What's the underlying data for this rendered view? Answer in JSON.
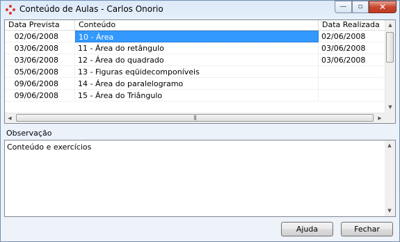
{
  "window": {
    "title": "Conteúdo de Aulas - Carlos Onorio",
    "minimize_glyph": "—",
    "maximize_glyph": "▫",
    "close_glyph": "✕"
  },
  "table": {
    "columns": [
      "Data Prevista",
      "Conteúdo",
      "Data Realizada"
    ],
    "rows": [
      {
        "prevista": "02/06/2008",
        "conteudo": "10 - Área",
        "realizada": "02/06/2008",
        "selected": true
      },
      {
        "prevista": "03/06/2008",
        "conteudo": "11 - Área do retângulo",
        "realizada": "03/06/2008"
      },
      {
        "prevista": "03/06/2008",
        "conteudo": "12 - Área do quadrado",
        "realizada": "03/06/2008"
      },
      {
        "prevista": "05/06/2008",
        "conteudo": "13 - Figuras eqüidecomponíveis",
        "realizada": ""
      },
      {
        "prevista": "09/06/2008",
        "conteudo": "14 - Área do paralelogramo",
        "realizada": ""
      },
      {
        "prevista": "09/06/2008",
        "conteudo": "15 - Área do Triângulo",
        "realizada": ""
      }
    ]
  },
  "observacao": {
    "label": "Observação",
    "text": "Conteúdo e exercícios"
  },
  "buttons": {
    "help": "Ajuda",
    "close": "Fechar"
  },
  "colors": {
    "selection": "#3399ff",
    "icon": "#e0322f"
  }
}
